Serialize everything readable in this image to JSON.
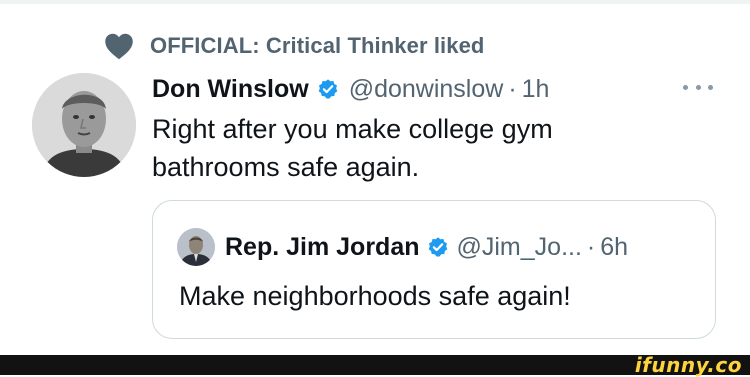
{
  "context": {
    "label": "OFFICIAL: Critical Thinker liked",
    "icon": "heart-icon"
  },
  "tweet": {
    "author_name": "Don Winslow",
    "handle": "@donwinslow",
    "separator": "·",
    "time": "1h",
    "text": "Right after you make college gym bathrooms safe again.",
    "verified": true
  },
  "quoted_tweet": {
    "author_name": "Rep. Jim Jordan",
    "handle": "@Jim_Jo...",
    "separator": "·",
    "time": "6h",
    "text": "Make neighborhoods safe again!",
    "verified": true
  },
  "footer": {
    "brand": "ifunny.co"
  },
  "colors": {
    "text_primary": "#0f1419",
    "text_secondary": "#536471",
    "verified_blue": "#1d9bf0",
    "border": "#cfd9de",
    "brand_yellow": "#ffd33d"
  }
}
